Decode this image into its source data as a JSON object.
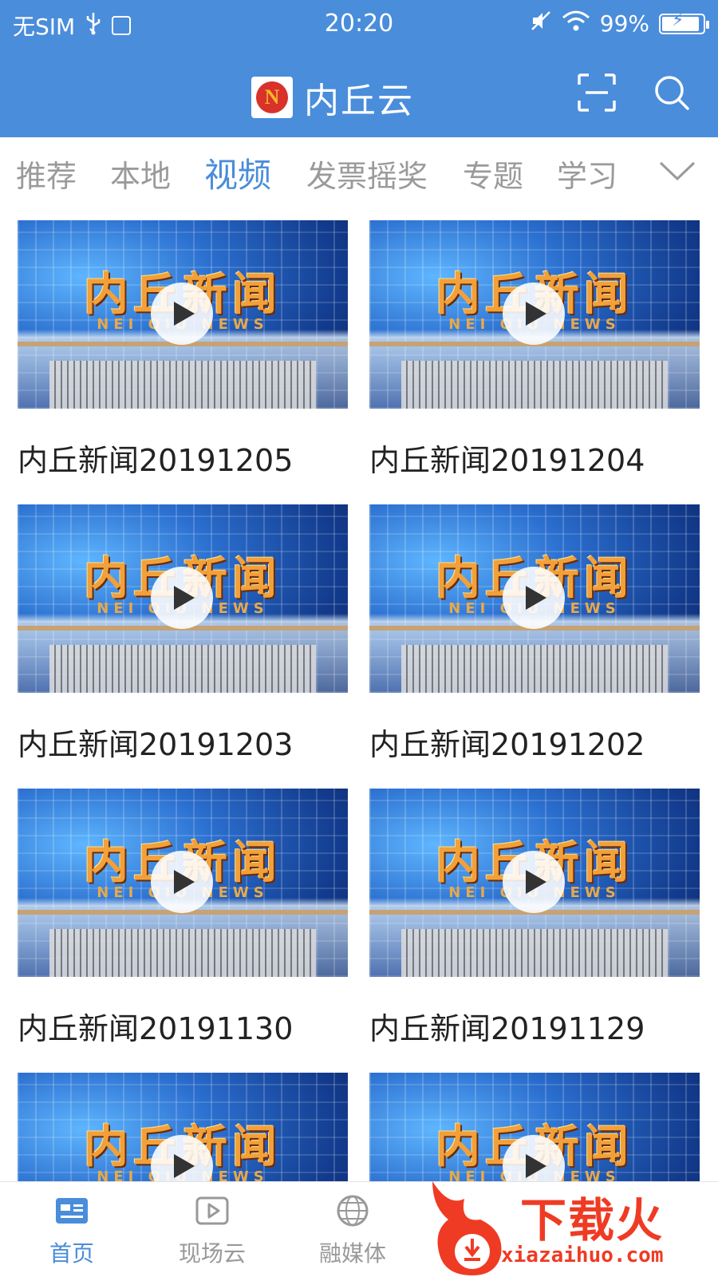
{
  "status_bar": {
    "carrier": "无SIM",
    "time": "20:20",
    "battery": "99%"
  },
  "header": {
    "title": "内丘云",
    "logo_letter": "N"
  },
  "tabs": [
    {
      "label": "推荐",
      "active": false
    },
    {
      "label": "本地",
      "active": false
    },
    {
      "label": "视频",
      "active": true
    },
    {
      "label": "发票摇奖",
      "active": false
    },
    {
      "label": "专题",
      "active": false
    },
    {
      "label": "学习",
      "active": false
    }
  ],
  "videos": [
    {
      "title": "内丘新闻20191205",
      "thumb_title": "内丘新闻",
      "thumb_sub": "NEI QIU NEWS"
    },
    {
      "title": "内丘新闻20191204",
      "thumb_title": "内丘新闻",
      "thumb_sub": "NEI QIU NEWS"
    },
    {
      "title": "内丘新闻20191203",
      "thumb_title": "内丘新闻",
      "thumb_sub": "NEI QIU NEWS"
    },
    {
      "title": "内丘新闻20191202",
      "thumb_title": "内丘新闻",
      "thumb_sub": "NEI QIU NEWS"
    },
    {
      "title": "内丘新闻20191130",
      "thumb_title": "内丘新闻",
      "thumb_sub": "NEI QIU NEWS"
    },
    {
      "title": "内丘新闻20191129",
      "thumb_title": "内丘新闻",
      "thumb_sub": "NEI QIU NEWS"
    },
    {
      "title": "",
      "thumb_title": "内丘新闻",
      "thumb_sub": "NEI QIU NEWS"
    },
    {
      "title": "",
      "thumb_title": "内丘新闻",
      "thumb_sub": "NEI QIU NEWS"
    }
  ],
  "bottom_nav": [
    {
      "label": "首页",
      "icon": "news-icon",
      "active": true
    },
    {
      "label": "现场云",
      "icon": "play-box-icon",
      "active": false
    },
    {
      "label": "融媒体",
      "icon": "globe-icon",
      "active": false
    }
  ],
  "watermark": {
    "text": "下载火",
    "url": "xiazaihuo.com"
  },
  "colors": {
    "accent": "#4a8ddb",
    "tab_inactive": "#9a9a9a",
    "watermark": "#ef3b24"
  }
}
